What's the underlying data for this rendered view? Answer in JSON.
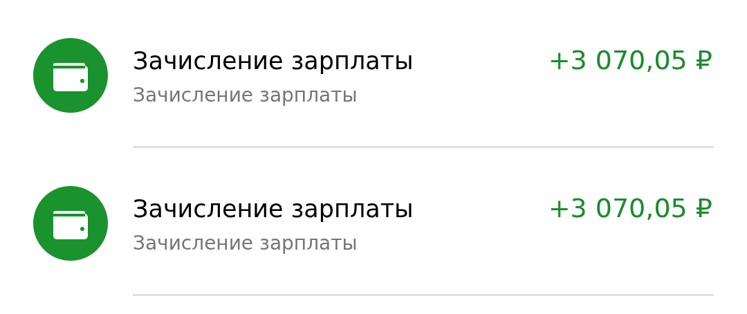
{
  "transactions": [
    {
      "title": "Зачисление зарплаты",
      "subtitle": "Зачисление зарплаты",
      "amount": "+3 070,05 ₽",
      "kind": "income"
    },
    {
      "title": "Зачисление зарплаты",
      "subtitle": "Зачисление зарплаты",
      "amount": "+3 070,05 ₽",
      "kind": "income"
    }
  ]
}
